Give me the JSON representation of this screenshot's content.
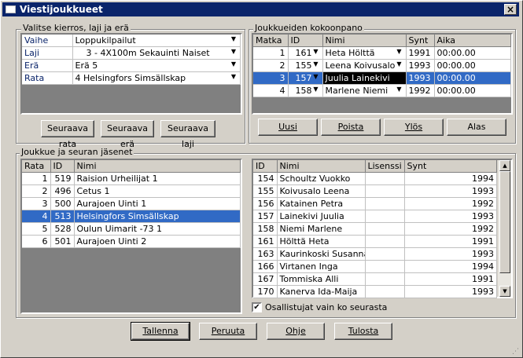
{
  "window": {
    "title": "Viestijoukkueet",
    "close_label": "×"
  },
  "selection": {
    "group_title": "Valitse kierros, laji ja erä",
    "rows": [
      {
        "label": "Vaihe",
        "value": "Loppukilpailut"
      },
      {
        "label": "Laji",
        "value": "    3 - 4X100m Sekauinti Naiset"
      },
      {
        "label": "Erä",
        "value": "Erä 5"
      },
      {
        "label": "Rata",
        "value": "4 Helsingfors Simsällskap"
      }
    ],
    "buttons": {
      "next_lane": "Seuraava rata",
      "next_heat": "Seuraava erä",
      "next_event": "Seuraava laji"
    }
  },
  "composition": {
    "group_title": "Joukkueiden kokoonpano",
    "headers": [
      "Matka",
      "ID",
      "Nimi",
      "Synt",
      "Aika"
    ],
    "rows": [
      {
        "matka": "1",
        "id": "161",
        "name": "Heta Hölttä",
        "synt": "1991",
        "aika": "00:00.00"
      },
      {
        "matka": "2",
        "id": "155",
        "name": "Leena Koivusalo",
        "synt": "1993",
        "aika": "00:00.00"
      },
      {
        "matka": "3",
        "id": "157",
        "name": "Juulia Lainekivi",
        "synt": "1993",
        "aika": "00:00.00"
      },
      {
        "matka": "4",
        "id": "158",
        "name": "Marlene Niemi",
        "synt": "1992",
        "aika": "00:00.00"
      }
    ],
    "buttons": {
      "new": "Uusi",
      "delete": "Poista",
      "up": "Ylös",
      "down": "Alas"
    }
  },
  "teams": {
    "group_title": "Joukkue ja seuran jäsenet",
    "headers": [
      "Rata",
      "ID",
      "Nimi"
    ],
    "rows": [
      {
        "rata": "1",
        "id": "519",
        "name": "Raision Urheilijat 1"
      },
      {
        "rata": "2",
        "id": "496",
        "name": "Cetus 1"
      },
      {
        "rata": "3",
        "id": "500",
        "name": "Aurajoen Uinti 1"
      },
      {
        "rata": "4",
        "id": "513",
        "name": "Helsingfors Simsällskap"
      },
      {
        "rata": "5",
        "id": "528",
        "name": "Oulun Uimarit -73 1"
      },
      {
        "rata": "6",
        "id": "501",
        "name": "Aurajoen Uinti 2"
      }
    ]
  },
  "members": {
    "headers": [
      "ID",
      "Nimi",
      "Lisenssi",
      "Synt"
    ],
    "rows": [
      {
        "id": "154",
        "name": "Schoultz Vuokko",
        "lisenssi": "",
        "synt": "1994"
      },
      {
        "id": "155",
        "name": "Koivusalo Leena",
        "lisenssi": "",
        "synt": "1993"
      },
      {
        "id": "156",
        "name": "Katainen Petra",
        "lisenssi": "",
        "synt": "1992"
      },
      {
        "id": "157",
        "name": "Lainekivi Juulia",
        "lisenssi": "",
        "synt": "1993"
      },
      {
        "id": "158",
        "name": "Niemi Marlene",
        "lisenssi": "",
        "synt": "1992"
      },
      {
        "id": "161",
        "name": "Hölttä Heta",
        "lisenssi": "",
        "synt": "1991"
      },
      {
        "id": "163",
        "name": "Kaurinkoski Susanna",
        "lisenssi": "",
        "synt": "1993"
      },
      {
        "id": "166",
        "name": "Virtanen Inga",
        "lisenssi": "",
        "synt": "1994"
      },
      {
        "id": "167",
        "name": "Tommiska Alli",
        "lisenssi": "",
        "synt": "1991"
      },
      {
        "id": "170",
        "name": "Kanerva Ida-Maija",
        "lisenssi": "",
        "synt": "1993"
      }
    ],
    "checkbox_label": "Osallistujat vain ko seurasta",
    "checkbox_checked": true
  },
  "footer": {
    "save": "Tallenna",
    "cancel": "Peruuta",
    "help": "Ohje",
    "print": "Tulosta"
  },
  "colors": {
    "selection": "#316ac5",
    "titlebar": "#0a246a",
    "face": "#d4d0c8"
  }
}
